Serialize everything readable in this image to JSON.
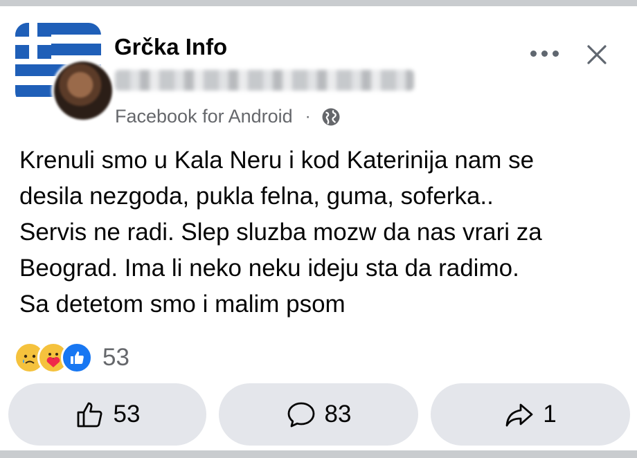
{
  "post": {
    "group_name": "Grčka Info",
    "source": "Facebook for Android",
    "separator": "·",
    "lines": [
      "Krenuli smo u Kala Neru i kod Katerinija nam se",
      "desila nezgoda, pukla felna, guma, soferka..",
      "Servis ne radi. Slep sluzba mozw da nas vrari za",
      "Beograd. Ima li neko neku ideju sta da radimo.",
      "Sa detetom smo i malim psom"
    ]
  },
  "reactions": {
    "icons": [
      "sad-reaction-icon",
      "care-reaction-icon",
      "like-reaction-icon"
    ],
    "count": "53"
  },
  "actions": {
    "like_count": "53",
    "comment_count": "83",
    "share_count": "1"
  },
  "colors": {
    "accent": "#1877f2",
    "secondary_text": "#65676b",
    "button_bg": "#e4e6eb"
  }
}
